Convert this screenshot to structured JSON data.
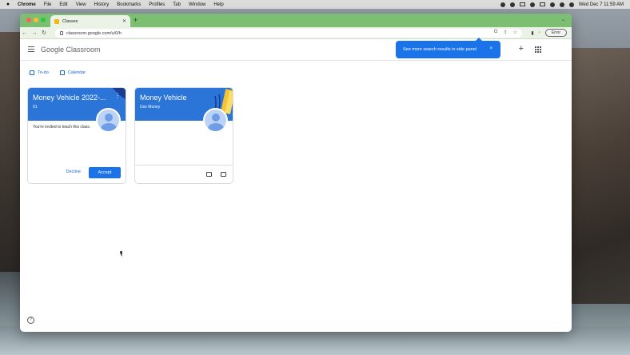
{
  "menubar": {
    "app": "Chrome",
    "items": [
      "File",
      "Edit",
      "View",
      "History",
      "Bookmarks",
      "Profiles",
      "Tab",
      "Window",
      "Help"
    ],
    "clock": "Wed Dec 7  11:59 AM"
  },
  "browser": {
    "tab_title": "Classes",
    "url": "classroom.google.com/u/0/h",
    "error_label": "Error"
  },
  "header": {
    "logo_google": "Google",
    "logo_product": "Classroom"
  },
  "popup": {
    "text": "See more search results in side panel",
    "close": "×"
  },
  "subnav": {
    "todo": "To-do",
    "calendar": "Calendar"
  },
  "cards": [
    {
      "title": "Money Vehicle 2022-...",
      "subtitle": "01",
      "invite_text": "You're invited to teach this class.",
      "decline": "Decline",
      "accept": "Accept"
    },
    {
      "title": "Money Vehicle",
      "subtitle": "Use Money"
    }
  ],
  "help": "?",
  "colors": {
    "tabstrip": "#7cbf72",
    "banner": "#2b74d8",
    "accent": "#1a73e8"
  }
}
